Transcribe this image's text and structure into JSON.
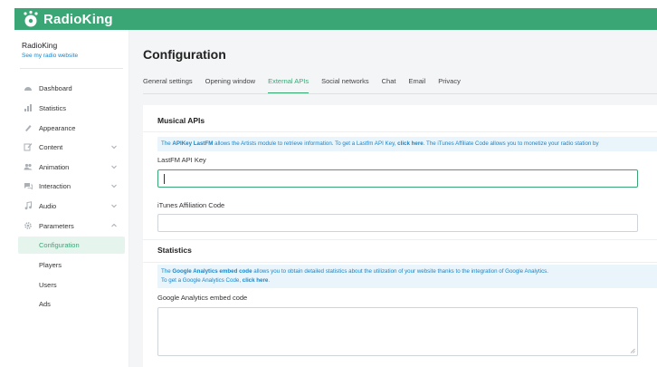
{
  "app": {
    "name": "RadioKing",
    "brand_color": "#3aa676",
    "link_color": "#1a85c7"
  },
  "sidebar": {
    "account_name": "RadioKing",
    "account_link": "See my radio website",
    "items": [
      {
        "label": "Dashboard",
        "icon": "dashboard-icon"
      },
      {
        "label": "Statistics",
        "icon": "chart-icon"
      },
      {
        "label": "Appearance",
        "icon": "brush-icon"
      },
      {
        "label": "Content",
        "icon": "edit-icon",
        "expandable": true
      },
      {
        "label": "Animation",
        "icon": "users-icon",
        "expandable": true
      },
      {
        "label": "Interaction",
        "icon": "chat-icon",
        "expandable": true
      },
      {
        "label": "Audio",
        "icon": "music-icon",
        "expandable": true
      },
      {
        "label": "Parameters",
        "icon": "gear-icon",
        "expandable": true,
        "expanded": true
      }
    ],
    "subitems": [
      {
        "label": "Configuration",
        "active": true
      },
      {
        "label": "Players"
      },
      {
        "label": "Users"
      },
      {
        "label": "Ads"
      }
    ]
  },
  "main": {
    "title": "Configuration",
    "tabs": [
      {
        "label": "General settings"
      },
      {
        "label": "Opening window"
      },
      {
        "label": "External APIs",
        "active": true
      },
      {
        "label": "Social networks"
      },
      {
        "label": "Chat"
      },
      {
        "label": "Email"
      },
      {
        "label": "Privacy"
      }
    ],
    "musical": {
      "title": "Musical APIs",
      "info_t1": "The ",
      "info_b1": "APIKey LastFM",
      "info_t2": " allows the Artists module to retrieve information. To get a Lastfm API Key, ",
      "info_b2": "click here",
      "info_t3": ". The iTunes Affiliate Code allows you to monetize your radio station by",
      "lastfm_label": "LastFM API Key",
      "lastfm_value": "",
      "itunes_label": "iTunes Affiliation Code",
      "itunes_value": ""
    },
    "statistics": {
      "title": "Statistics",
      "info_t1": "The ",
      "info_b1": "Google Analytics embed code",
      "info_t2": " allows you to obtain detailed statistics about the utilization of your website thanks to the integration of Google Analytics.",
      "info_t3": "To get a Google Analytics Code, ",
      "info_b2": "click here",
      "info_t4": ".",
      "ga_label": "Google Analytics embed code",
      "ga_value": ""
    }
  }
}
